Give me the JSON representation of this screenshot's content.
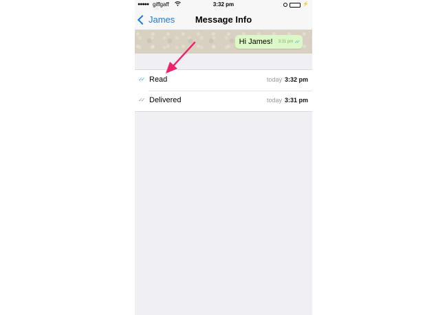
{
  "status_bar": {
    "signal": "●●●●●",
    "carrier": "giffgaff",
    "time": "3:32 pm"
  },
  "nav": {
    "back_label": "James",
    "title": "Message Info"
  },
  "message": {
    "text": "Hi James!",
    "time": "3:31 pm",
    "ticks": "✓✓"
  },
  "receipts": [
    {
      "label": "Read",
      "day": "today",
      "time": "3:32 pm",
      "ticks": "✓✓"
    },
    {
      "label": "Delivered",
      "day": "today",
      "time": "3:31 pm",
      "ticks": "✓✓"
    }
  ],
  "colors": {
    "accent": "#1a7ae0",
    "read_tick": "#34b7f1",
    "bubble": "#dcf8c6",
    "annotation_arrow": "#f0226a"
  }
}
